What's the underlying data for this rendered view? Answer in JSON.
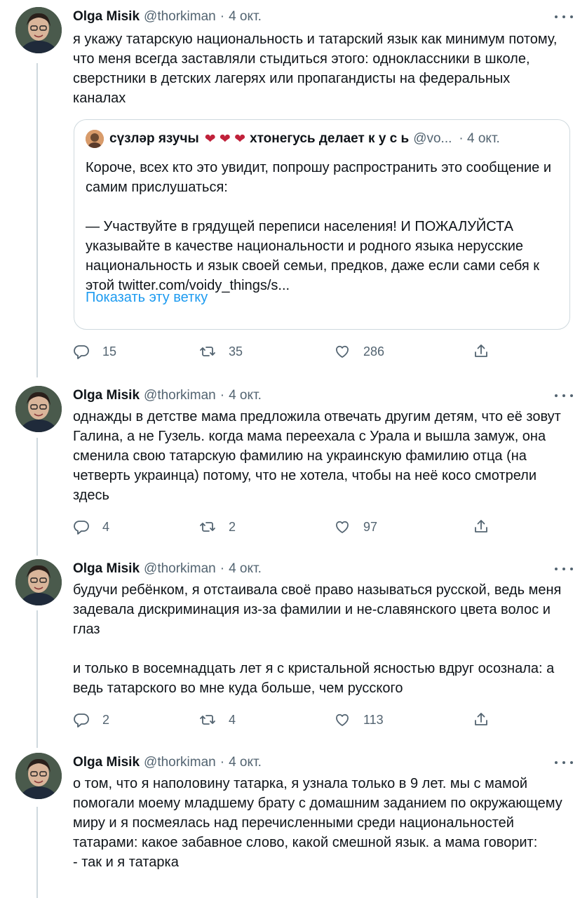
{
  "tweets": [
    {
      "name": "Olga Misik",
      "handle": "@thorkiman",
      "date": "4 окт.",
      "text": "я укажу татарскую национальность и татарский язык как минимум потому, что меня всегда заставляли стыдиться этого: одноклассники в школе, сверстники в детских лагерях или пропагандисты на федеральных каналах",
      "quote": {
        "name": "сүзләр язучы",
        "hearts": "❤︎ ❤︎ ❤︎",
        "name2": "хтонегусь делает к у с ь",
        "handle": "@vo...",
        "date": "· 4 окт.",
        "text": "Короче, всех кто это увидит, попрошу распространить это сообщение и самим прислушаться:\n\n— Участвуйте в грядущей переписи населения! И ПОЖАЛУЙСТА указывайте в качестве национальности и родного языка нерусские национальность и язык своей семьи, предков, даже если сами себя к этой twitter.com/voidy_things/s...",
        "show_thread": "Показать эту ветку"
      },
      "replies": "15",
      "retweets": "35",
      "likes": "286"
    },
    {
      "name": "Olga Misik",
      "handle": "@thorkiman",
      "date": "4 окт.",
      "text": "однажды в детстве мама предложила отвечать другим детям, что её зовут Галина, а не Гузель. когда мама переехала с Урала и вышла замуж, она сменила свою татарскую фамилию на украинскую фамилию отца (на четверть украинца) потому, что не хотела, чтобы на неё косо смотрели здесь",
      "replies": "4",
      "retweets": "2",
      "likes": "97"
    },
    {
      "name": "Olga Misik",
      "handle": "@thorkiman",
      "date": "4 окт.",
      "text": "будучи ребёнком, я отстаивала своё право называться русской, ведь меня задевала дискриминация из-за фамилии и не-славянского цвета волос и глаз\n\nи только в восемнадцать лет я с кристальной ясностью вдруг осознала: а ведь татарского во мне куда больше, чем русского",
      "replies": "2",
      "retweets": "4",
      "likes": "113"
    },
    {
      "name": "Olga Misik",
      "handle": "@thorkiman",
      "date": "4 окт.",
      "text": "о том, что я наполовину татарка, я узнала только в 9 лет. мы с мамой помогали моему младшему брату с домашним заданием по окружающему миру и я посмеялась над перечисленными среди национальностей татарами: какое забавное слово, какой смешной язык. а мама говорит:\n- так и я татарка"
    }
  ],
  "icons": {
    "reply": "reply-icon",
    "retweet": "retweet-icon",
    "like": "heart-icon",
    "share": "share-icon",
    "more": "more-icon"
  },
  "colors": {
    "text": "#0f1419",
    "muted": "#536471",
    "link": "#1d9bf0",
    "border": "#cfd9de"
  }
}
